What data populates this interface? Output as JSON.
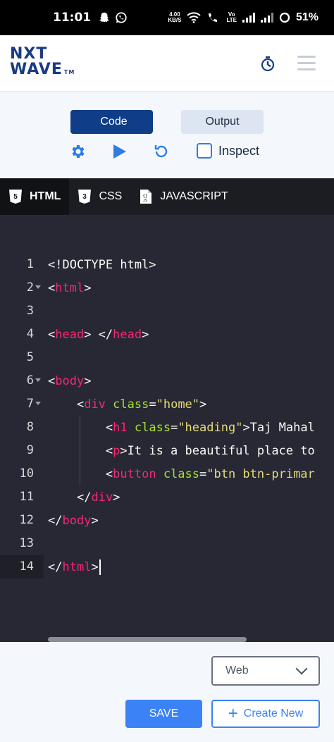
{
  "status_bar": {
    "time": "11:01",
    "network_speed_value": "4.00",
    "network_speed_unit": "KB/S",
    "volte_top": "Vo",
    "volte_bottom": "LTE",
    "battery": "51%"
  },
  "header": {
    "logo_line1": "NXT",
    "logo_line2": "WAVE",
    "logo_tm": "TM"
  },
  "toolbar": {
    "code_label": "Code",
    "output_label": "Output",
    "inspect_label": "Inspect"
  },
  "file_tabs": [
    {
      "label": "HTML"
    },
    {
      "label": "CSS"
    },
    {
      "label": "JAVASCRIPT"
    }
  ],
  "editor": {
    "line_numbers": [
      "1",
      "2",
      "3",
      "4",
      "5",
      "6",
      "7",
      "8",
      "9",
      "10",
      "11",
      "12",
      "13",
      "14"
    ],
    "lines": {
      "l1": "<!DOCTYPE html>",
      "l2_open": "<",
      "l2_tag": "html",
      "l2_close": ">",
      "l4_a": "<",
      "l4_tag1": "head",
      "l4_b": "> </",
      "l4_tag2": "head",
      "l4_c": ">",
      "l6_open": "<",
      "l6_tag": "body",
      "l6_close": ">",
      "l7_open": "<",
      "l7_tag": "div",
      "l7_attr": "class",
      "l7_eq": "=",
      "l7_str": "\"home\"",
      "l7_close": ">",
      "l8_open": "<",
      "l8_tag": "h1",
      "l8_attr": "class",
      "l8_eq": "=",
      "l8_str": "\"heading\"",
      "l8_text": ">Taj Mahal",
      "l9_open": "<",
      "l9_tag": "p",
      "l9_text": ">It is a beautiful place to",
      "l10_open": "<",
      "l10_tag": "button",
      "l10_attr": "class",
      "l10_eq": "=",
      "l10_str": "\"btn btn-primar",
      "l11_open": "</",
      "l11_tag": "div",
      "l11_close": ">",
      "l12_open": "</",
      "l12_tag": "body",
      "l12_close": ">",
      "l14_open": "</",
      "l14_tag": "html",
      "l14_close": ">"
    }
  },
  "bottom": {
    "select_value": "Web",
    "save_label": "SAVE",
    "create_label": "Create New",
    "create_plus": "+"
  },
  "colors": {
    "code_button": "#0f3d87",
    "accent_blue": "#3b82f6",
    "editor_bg": "#272834",
    "tag_color": "#f92672",
    "attr_color": "#a6e22e",
    "string_color": "#e6db74"
  }
}
